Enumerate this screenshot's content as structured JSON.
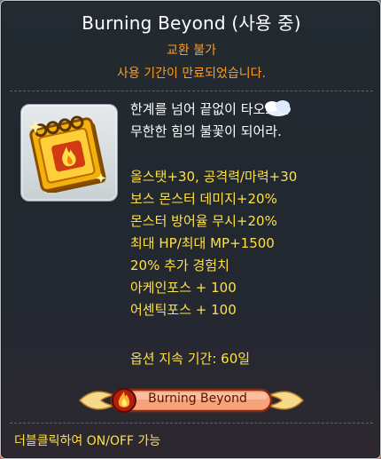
{
  "tooltip": {
    "title": "Burning Beyond (사용 중)",
    "trade_status": "교환 불가",
    "expiry_notice": "사용 기간이 만료되었습니다.",
    "description_line1": "한계를 넘어 끝없이 타오르는",
    "description_line2": "무한한 힘의 불꽃이 되어라.",
    "stats": [
      "올스탯+30, 공격력/마력+30",
      "보스 몬스터 데미지+20%",
      "몬스터 방어율 무시+20%",
      "최대 HP/최대 MP+1500",
      "20% 추가 경험치",
      "아케인포스 + 100",
      "어센틱포스 + 100"
    ],
    "option_duration": "옵션 지속 기간: 60일",
    "badge_label": "Burning Beyond",
    "usage_hint": "더블클릭하여 ON/OFF 가능"
  },
  "colors": {
    "title": "#ffffff",
    "warning": "#ff9b1f",
    "stat": "#ffe044",
    "panel": "#191f25"
  },
  "icons": {
    "item": "burning-book-icon",
    "cursor_sparkle": "sparkle-cloud-icon"
  }
}
